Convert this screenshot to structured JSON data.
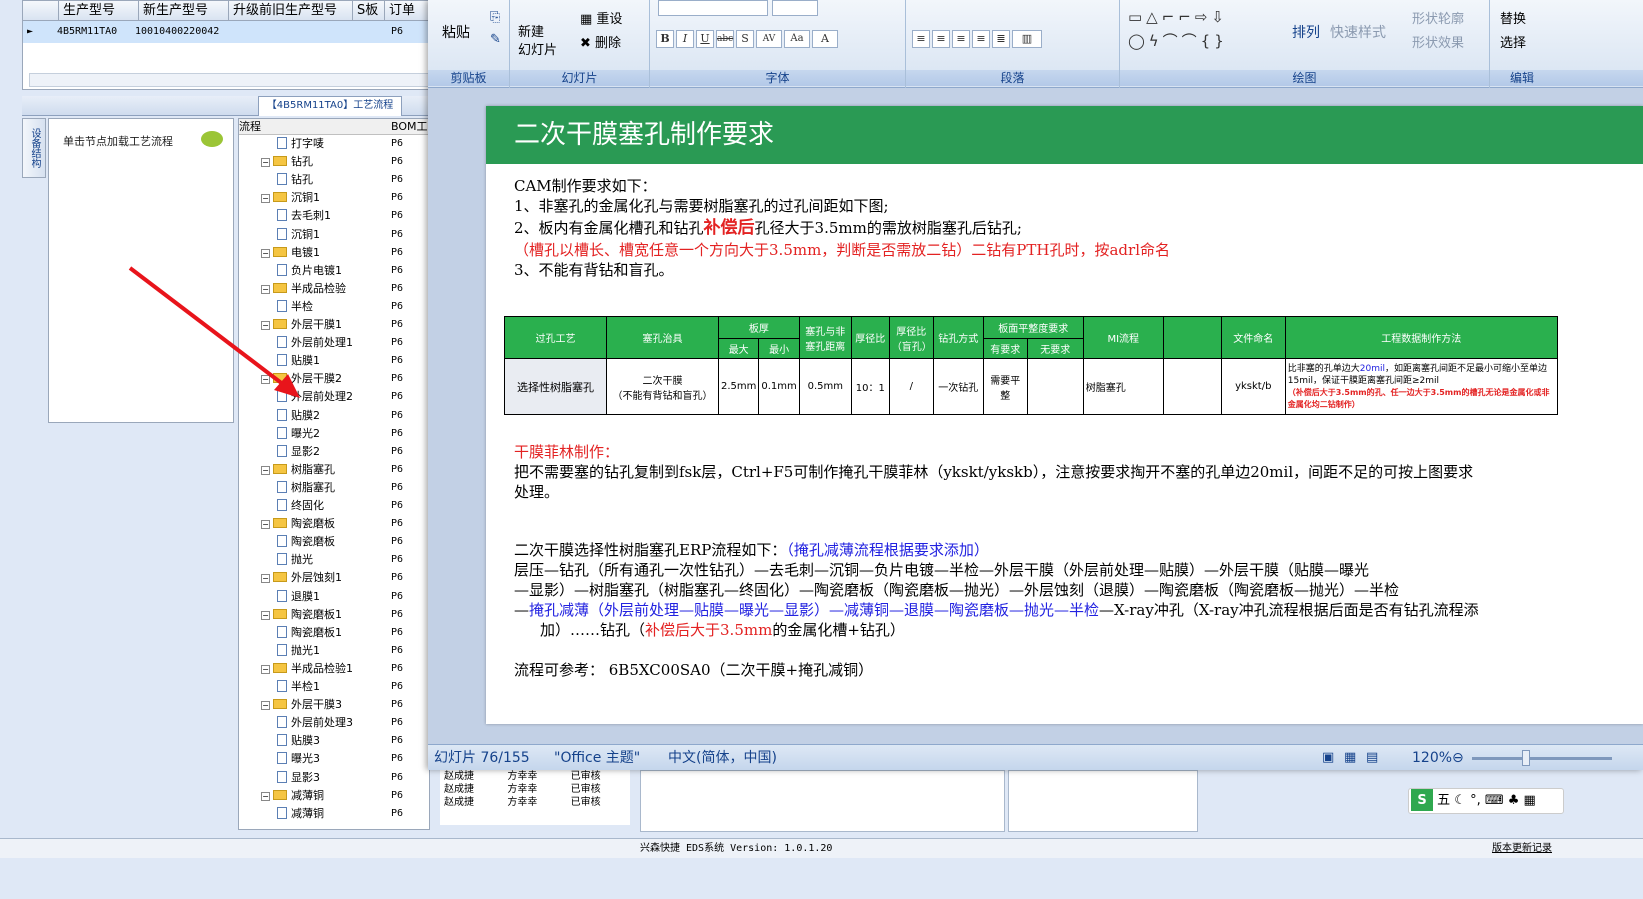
{
  "erp": {
    "grid_headers": [
      "生产型号",
      "新生产型号",
      "升级前旧生产型号",
      "S板",
      "订单"
    ],
    "grid_row": {
      "model": "4B5RM11TA0",
      "new_model": "10010400220042",
      "s": "P6"
    },
    "process_tab": "【4B5RM11TA0】工艺流程",
    "left_vtab": "设备结构",
    "left_hint": "单击节点加载工艺流程",
    "tree_headers": {
      "flow": "流程",
      "bom": "BOM工"
    },
    "tree": [
      {
        "label": "打字唛",
        "type": "doc",
        "level": 2,
        "val": "P6"
      },
      {
        "label": "钻孔",
        "type": "folder",
        "level": 1,
        "val": "P6"
      },
      {
        "label": "钻孔",
        "type": "doc",
        "level": 2,
        "val": "P6"
      },
      {
        "label": "沉铜1",
        "type": "folder",
        "level": 1,
        "val": "P6"
      },
      {
        "label": "去毛刺1",
        "type": "doc",
        "level": 2,
        "val": "P6"
      },
      {
        "label": "沉铜1",
        "type": "doc",
        "level": 2,
        "val": "P6"
      },
      {
        "label": "电镀1",
        "type": "folder",
        "level": 1,
        "val": "P6"
      },
      {
        "label": "负片电镀1",
        "type": "doc",
        "level": 2,
        "val": "P6"
      },
      {
        "label": "半成品检验",
        "type": "folder",
        "level": 1,
        "val": "P6"
      },
      {
        "label": "半检",
        "type": "doc",
        "level": 2,
        "val": "P6"
      },
      {
        "label": "外层干膜1",
        "type": "folder",
        "level": 1,
        "val": "P6"
      },
      {
        "label": "外层前处理1",
        "type": "doc",
        "level": 2,
        "val": "P6"
      },
      {
        "label": "贴膜1",
        "type": "doc",
        "level": 2,
        "val": "P6"
      },
      {
        "label": "外层干膜2",
        "type": "folder",
        "level": 1,
        "val": "P6"
      },
      {
        "label": "外层前处理2",
        "type": "doc",
        "level": 2,
        "val": "P6"
      },
      {
        "label": "贴膜2",
        "type": "doc",
        "level": 2,
        "val": "P6"
      },
      {
        "label": "曝光2",
        "type": "doc",
        "level": 2,
        "val": "P6"
      },
      {
        "label": "显影2",
        "type": "doc",
        "level": 2,
        "val": "P6"
      },
      {
        "label": "树脂塞孔",
        "type": "folder",
        "level": 1,
        "val": "P6"
      },
      {
        "label": "树脂塞孔",
        "type": "doc",
        "level": 2,
        "val": "P6"
      },
      {
        "label": "终固化",
        "type": "doc",
        "level": 2,
        "val": "P6"
      },
      {
        "label": "陶瓷磨板",
        "type": "folder",
        "level": 1,
        "val": "P6"
      },
      {
        "label": "陶瓷磨板",
        "type": "doc",
        "level": 2,
        "val": "P6"
      },
      {
        "label": "抛光",
        "type": "doc",
        "level": 2,
        "val": "P6"
      },
      {
        "label": "外层蚀刻1",
        "type": "folder",
        "level": 1,
        "val": "P6"
      },
      {
        "label": "退膜1",
        "type": "doc",
        "level": 2,
        "val": "P6"
      },
      {
        "label": "陶瓷磨板1",
        "type": "folder",
        "level": 1,
        "val": "P6"
      },
      {
        "label": "陶瓷磨板1",
        "type": "doc",
        "level": 2,
        "val": "P6"
      },
      {
        "label": "抛光1",
        "type": "doc",
        "level": 2,
        "val": "P6"
      },
      {
        "label": "半成品检验1",
        "type": "folder",
        "level": 1,
        "val": "P6"
      },
      {
        "label": "半检1",
        "type": "doc",
        "level": 2,
        "val": "P6"
      },
      {
        "label": "外层干膜3",
        "type": "folder",
        "level": 1,
        "val": "P6"
      },
      {
        "label": "外层前处理3",
        "type": "doc",
        "level": 2,
        "val": "P6"
      },
      {
        "label": "贴膜3",
        "type": "doc",
        "level": 2,
        "val": "P6"
      },
      {
        "label": "曝光3",
        "type": "doc",
        "level": 2,
        "val": "P6"
      },
      {
        "label": "显影3",
        "type": "doc",
        "level": 2,
        "val": "P6"
      },
      {
        "label": "减薄铜",
        "type": "folder",
        "level": 1,
        "val": "P6"
      },
      {
        "label": "减薄铜",
        "type": "doc",
        "level": 2,
        "val": "P6"
      }
    ],
    "bottom_rows": [
      [
        "赵成捷",
        "方幸幸",
        "已审核"
      ],
      [
        "赵成捷",
        "方幸幸",
        "已审核"
      ],
      [
        "赵成捷",
        "方幸幸",
        "已审核"
      ]
    ],
    "status_center": "兴森快捷 EDS系统 Version: 1.0.1.20",
    "status_right": "版本更新记录"
  },
  "ribbon": {
    "clipboard": {
      "paste": "粘贴",
      "group": "剪贴板"
    },
    "slides": {
      "new_slide": "新建\n幻灯片",
      "reset": "重设",
      "delete": "删除",
      "group": "幻灯片"
    },
    "font": {
      "group": "字体",
      "buttons": [
        "B",
        "I",
        "U",
        "abc",
        "S",
        "AV",
        "Aa",
        "A"
      ]
    },
    "paragraph": {
      "group": "段落"
    },
    "drawing": {
      "arrange": "排列",
      "quick_styles": "快速样式",
      "shape_outline": "形状轮廓",
      "shape_effects": "形状效果",
      "group": "绘图"
    },
    "editing": {
      "replace": "替换",
      "select": "选择",
      "group": "编辑"
    }
  },
  "slide": {
    "title": "二次干膜塞孔制作要求",
    "intro": "CAM制作要求如下：",
    "req1": "1、非塞孔的金属化孔与需要树脂塞孔的过孔间距如下图;",
    "req2_a": "2、板内有金属化槽孔和钻孔",
    "req2_b": "补偿后",
    "req2_c": "孔径大于3.5mm的需放树脂塞孔后钻孔;",
    "req2_note": "（槽孔以槽长、槽宽任意一个方向大于3.5mm，判断是否需放二钻）二钻有PTH孔时，按adrl命名",
    "req3": "3、不能有背钻和盲孔。",
    "table": {
      "h_process": "过孔工艺",
      "h_tool": "塞孔治具",
      "h_thick": "板厚",
      "h_max": "最大",
      "h_min": "最小",
      "h_dist": "塞孔与非塞孔距离",
      "h_ratio": "厚径比",
      "h_ratio_blind": "厚径比（盲孔）",
      "h_drill": "钻孔方式",
      "h_flat": "板面平整度要求",
      "h_need": "有要求",
      "h_noneed": "无要求",
      "h_mi": "MI流程",
      "h_file": "文件命名",
      "h_method": "工程数据制作方法",
      "r_process": "选择性树脂塞孔",
      "r_tool": "二次干膜\n（不能有背钻和盲孔）",
      "r_max": "2.5mm",
      "r_min": "0.1mm",
      "r_dist": "0.5mm",
      "r_ratio": "10：1",
      "r_ratio_blind": "/",
      "r_drill": "一次钻孔",
      "r_need": "需要平整",
      "r_mi": "树脂塞孔",
      "r_file": "ykskt/b",
      "r_method_a": "比非塞的孔单边大",
      "r_method_b": "20mil",
      "r_method_c": "，如距离塞孔间距不足最小可缩小至单边15mil，保证干膜距离塞孔间距≥2mil",
      "r_method_red": "（补偿后大于3.5mm的孔、任一边大于3.5mm的槽孔无论是金属化或非金属化均二钻制作）"
    },
    "film_title": "干膜菲林制作：",
    "film_1": "把不需要塞的钻孔复制到fsk层，Ctrl+F5可制作掩孔干膜菲林（ykskt/ykskb），注意按要求掏开不塞的孔单边20mil，间距不足的可按上图要求",
    "film_2": "处理。",
    "erp_title_a": "二次干膜选择性树脂塞孔ERP流程如下：",
    "erp_title_b": "（掩孔减薄流程根据要求添加）",
    "flow_1": "层压—钻孔（所有通孔一次性钻孔）—去毛刺—沉铜—负片电镀—半检—外层干膜（外层前处理—贴膜）—外层干膜（贴膜—曝光",
    "flow_2": "—显影）—树脂塞孔（树脂塞孔—终固化）—陶瓷磨板（陶瓷磨板—抛光）—外层蚀刻（退膜）—陶瓷磨板（陶瓷磨板—抛光）—半检",
    "flow_3a": "—",
    "flow_3b": "掩孔减薄（外层前处理—贴膜—曝光—显影）—减薄铜—退膜—陶瓷磨板—抛光—半检",
    "flow_3c": "—X-ray冲孔（X-ray冲孔流程根据后面是否有钻孔流程添",
    "flow_4a": "加）……钻孔（",
    "flow_4b": "补偿后大于3.5mm",
    "flow_4c": "的金属化槽+钻孔）",
    "ref": "流程可参考： 6B5XC00SA0（二次干膜+掩孔减铜）"
  },
  "ppt_status": {
    "slide_no": "幻灯片 76/155",
    "theme": "\"Office 主题\"",
    "lang": "中文(简体，中国)",
    "zoom": "120%"
  },
  "ime": {
    "label": "五"
  },
  "colors": {
    "title_bar": "#2a9a54",
    "accent_red": "#e32222",
    "accent_blue": "#2222e0",
    "arrow": "#e8141b"
  }
}
